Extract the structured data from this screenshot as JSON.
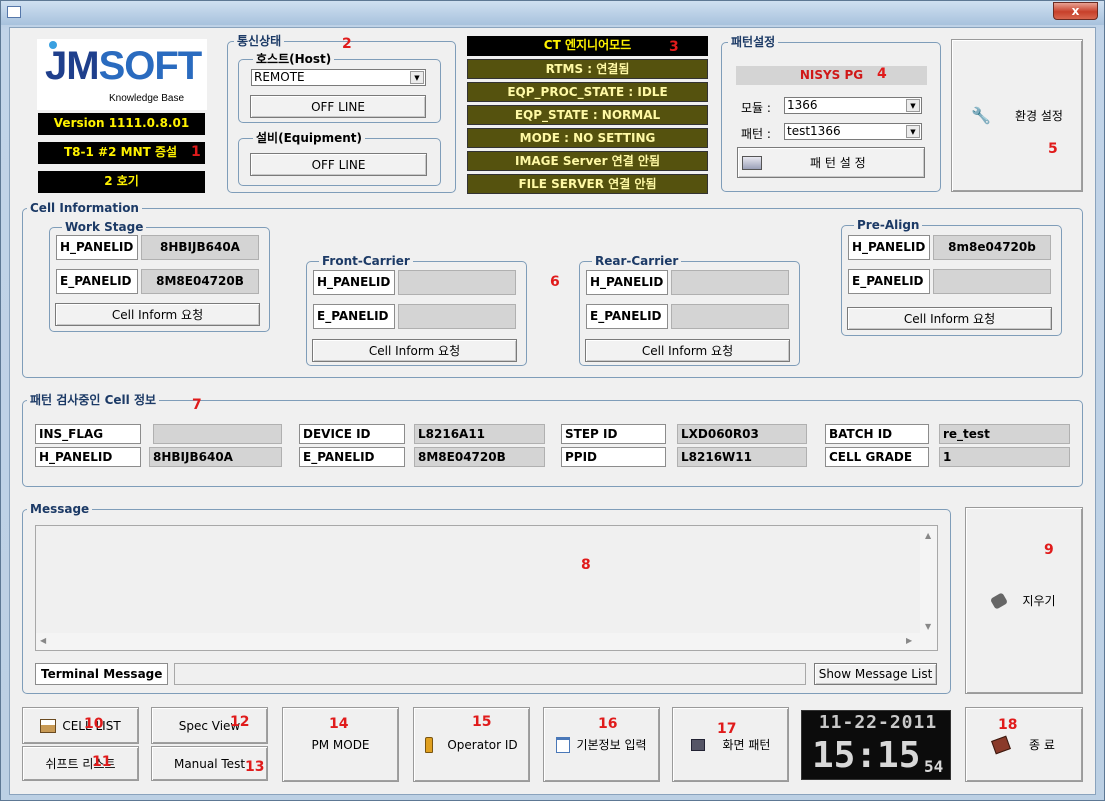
{
  "window": {
    "close_label": "x"
  },
  "logo": {
    "brand_j": "J",
    "brand_m": "M",
    "brand_rest": "SOFT",
    "tagline": "Knowledge Base"
  },
  "info": {
    "version": "Version 1111.0.8.01",
    "unit": "T8-1 #2 MNT 증설",
    "machine": "2 호기"
  },
  "comm": {
    "title": "통신상태",
    "host_title": "호스트(Host)",
    "host_mode": "REMOTE",
    "host_button": "OFF LINE",
    "eq_title": "설비(Equipment)",
    "eq_button": "OFF LINE"
  },
  "statuses": {
    "engineer_mode": "CT 엔지니어모드",
    "items": [
      "RTMS : 연결됨",
      "EQP_PROC_STATE : IDLE",
      "EQP_STATE : NORMAL",
      "MODE : NO SETTING",
      "IMAGE Server 연결 안됨",
      "FILE SERVER 연결 안됨"
    ]
  },
  "pattern": {
    "title": "패턴설정",
    "pg_name": "NISYS PG",
    "module_label": "모듈 :",
    "module_value": "1366",
    "pattern_label": "패턴 :",
    "pattern_value": "test1366",
    "set_button": "패 턴 설 정"
  },
  "env_button": "환경 설정",
  "cell_info": {
    "title": "Cell Information",
    "work_stage": {
      "title": "Work Stage",
      "h_label": "H_PANELID",
      "h_value": "8HBIJB640A",
      "e_label": "E_PANELID",
      "e_value": "8M8E04720B",
      "button": "Cell Inform 요청"
    },
    "front_carrier": {
      "title": "Front-Carrier",
      "h_label": "H_PANELID",
      "h_value": "",
      "e_label": "E_PANELID",
      "e_value": "",
      "button": "Cell Inform 요청"
    },
    "rear_carrier": {
      "title": "Rear-Carrier",
      "h_label": "H_PANELID",
      "h_value": "",
      "e_label": "E_PANELID",
      "e_value": "",
      "button": "Cell Inform 요청"
    },
    "pre_align": {
      "title": "Pre-Align",
      "h_label": "H_PANELID",
      "h_value": "8m8e04720b",
      "e_label": "E_PANELID",
      "e_value": "",
      "button": "Cell Inform 요청"
    }
  },
  "inspect": {
    "title": "패턴 검사중인 Cell 정보",
    "row1": [
      {
        "label": "INS_FLAG",
        "value": ""
      },
      {
        "label": "DEVICE ID",
        "value": "L8216A11"
      },
      {
        "label": "STEP ID",
        "value": "LXD060R03"
      },
      {
        "label": "BATCH ID",
        "value": "re_test"
      }
    ],
    "row2": [
      {
        "label": "H_PANELID",
        "value": "8HBIJB640A"
      },
      {
        "label": "E_PANELID",
        "value": "8M8E04720B"
      },
      {
        "label": "PPID",
        "value": "L8216W11"
      },
      {
        "label": "CELL GRADE",
        "value": "1"
      }
    ]
  },
  "message": {
    "title": "Message",
    "terminal_label": "Terminal Message",
    "terminal_value": "",
    "show_list": "Show Message List"
  },
  "clear_button": "지우기",
  "bottom": {
    "cell_list": "CELL LIST",
    "shift_list": "쉬프트 리스트",
    "spec_view": "Spec View",
    "manual_test": "Manual Test",
    "pm_mode": "PM MODE",
    "operator_id": "Operator ID",
    "basic_info": "기본정보 입력",
    "screen_pattern": "화면 패턴",
    "exit": "종 료"
  },
  "clock": {
    "date": "11-22-2011",
    "hm": "15:15",
    "sec": "54"
  },
  "annotations": [
    "1",
    "2",
    "3",
    "4",
    "5",
    "6",
    "7",
    "8",
    "9",
    "10",
    "11",
    "12",
    "13",
    "14",
    "15",
    "16",
    "17",
    "18"
  ],
  "colors": {
    "status_bg": "#55520e",
    "status_text": "#fff9a5",
    "annotation": "#e01b1b",
    "panel_border": "#7f9db9"
  }
}
